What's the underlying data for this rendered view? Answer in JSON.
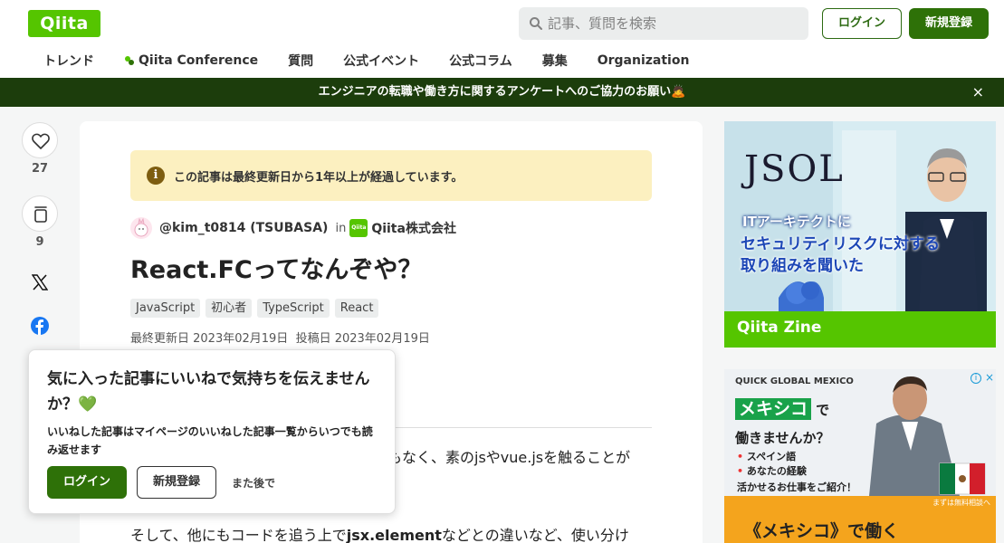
{
  "header": {
    "logo": "Qiita",
    "search_placeholder": "記事、質問を検索",
    "login": "ログイン",
    "signup": "新規登録"
  },
  "nav": [
    "トレンド",
    "Qiita Conference",
    "質問",
    "公式イベント",
    "公式コラム",
    "募集",
    "Organization"
  ],
  "banner": {
    "text": "エンジニアの転職や働き方に関するアンケートへのご協力のお願い🙇",
    "close": "×"
  },
  "rail": {
    "likes": "27",
    "stocks": "9"
  },
  "article": {
    "notice": "この記事は最終更新日から1年以上が経過しています。",
    "author": "@kim_t0814 (TSUBASA)",
    "in": "in",
    "org_logo": "Qiita",
    "org": "Qiita株式会社",
    "title": "React.FCってなんぞや？",
    "tags": [
      "JavaScript",
      "初心者",
      "TypeScript",
      "React"
    ],
    "updated": "最終更新日 2023年02月19日",
    "posted": "投稿日 2023年02月19日",
    "body1": "もなく、素のjsやvue.jsを触ることが",
    "body2_pre": "そして、他にもコードを追う上で",
    "body2_bold": "jsx.element",
    "body2_post": "などとの違いなど、使い分け"
  },
  "popup": {
    "heading": "気に入った記事にいいねで気持ちを伝えませんか？💚",
    "text": "いいねした記事はマイページのいいねした記事一覧からいつでも読み返せます",
    "login": "ログイン",
    "signup": "新規登録",
    "later": "また後で"
  },
  "ad1": {
    "brand": "JSOL",
    "line1": "ITアーキテクトに",
    "line2": "セキュリティリスクに対する",
    "line3": "取り組みを聞いた",
    "footer": "Qiita Zine"
  },
  "ad2": {
    "brand": "QUICK GLOBAL MEXICO",
    "highlight": "メキシコ",
    "de": "で",
    "line2": "働きませんか？",
    "bullet1": "スペイン語",
    "bullet2": "あなたの経験",
    "line5": "活かせるお仕事をご紹介！",
    "note": "まずは無料相談へ",
    "bottom": "《メキシコ》で働く"
  }
}
